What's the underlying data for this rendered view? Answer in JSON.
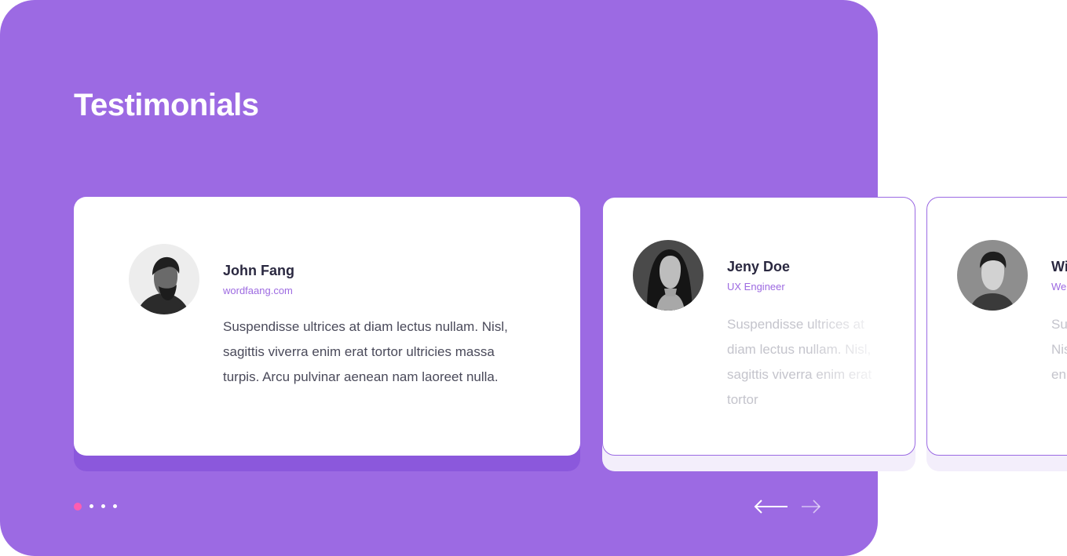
{
  "colors": {
    "panel": "#9c6ae3",
    "card_shadow_main": "#8b58dc",
    "card_shadow_side": "#f3eefb",
    "accent": "#9d6ae1",
    "active_dot": "#ff5db1"
  },
  "section": {
    "title": "Testimonials"
  },
  "testimonials": [
    {
      "name": "John Fang",
      "role": "wordfaang.com",
      "quote": "Suspendisse ultrices at diam lectus nullam. Nisl, sagittis viverra enim erat tortor ultricies massa turpis. Arcu pulvinar aenean nam laoreet nulla.",
      "avatar": "man-bearded-avatar"
    },
    {
      "name": "Jeny Doe",
      "role": "UX Engineer",
      "quote": "Suspendisse ultrices at diam lectus nullam. Nisl, sagittis viverra enim erat tortor",
      "avatar": "woman-avatar"
    },
    {
      "name": "Wi",
      "role": "We",
      "quote": "Su at Nis en",
      "avatar": "young-man-avatar"
    }
  ],
  "pagination": {
    "count": 4,
    "active_index": 0
  },
  "navigation": {
    "prev_icon": "arrow-left-icon",
    "next_icon": "arrow-right-icon"
  }
}
